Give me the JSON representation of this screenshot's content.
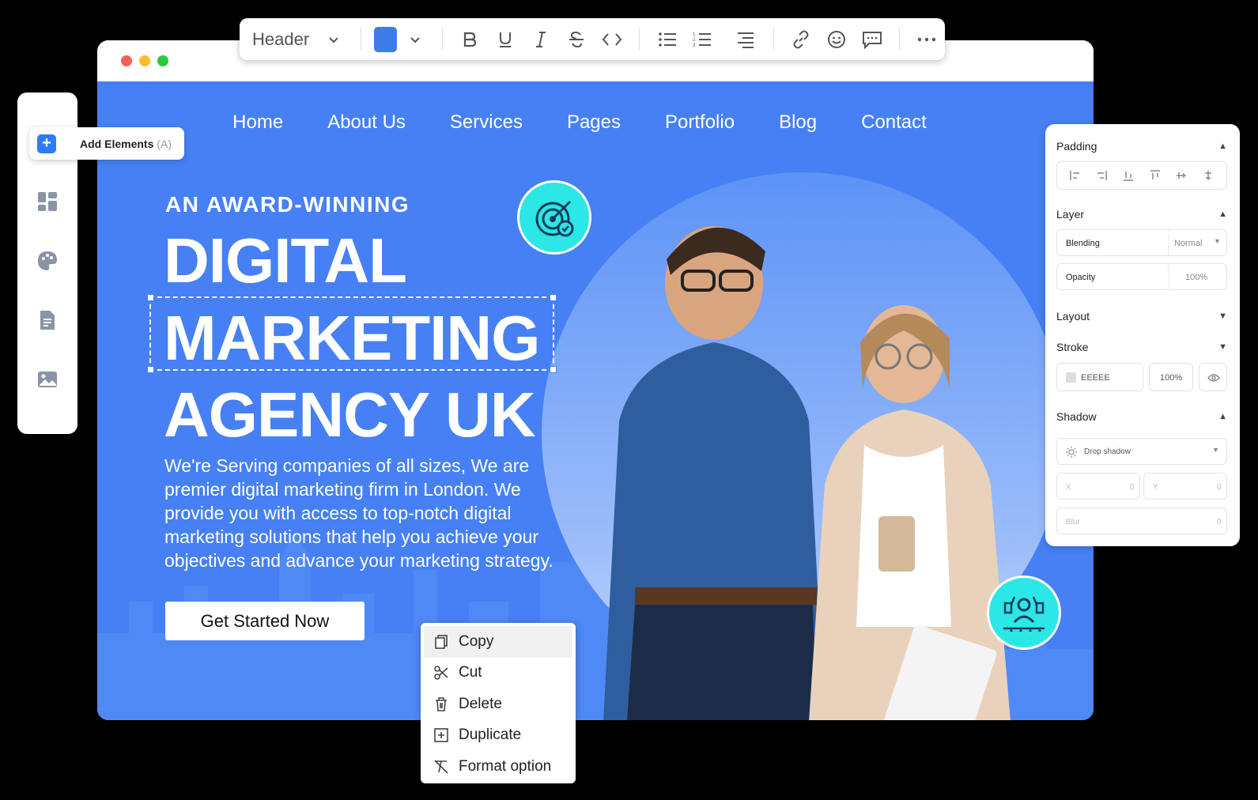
{
  "toolbar": {
    "block_type": "Header",
    "accent_color": "#3f7be8"
  },
  "sidebar": {
    "add_label": "Add Elements",
    "add_shortcut": "(A)",
    "icons": [
      "dashboard-icon",
      "palette-icon",
      "document-icon",
      "image-icon"
    ]
  },
  "site": {
    "nav": [
      "Home",
      "About Us",
      "Services",
      "Pages",
      "Portfolio",
      "Blog",
      "Contact"
    ],
    "eyebrow": "AN AWARD-WINNING",
    "headline_1": "DIGITAL",
    "headline_2": "MARKETING",
    "headline_3": "AGENCY UK",
    "description": "We're Serving companies of all sizes, We are premier digital marketing firm in London. We provide you with access to top-notch digital marketing solutions that help you achieve your objectives and advance your marketing strategy.",
    "cta": "Get Started Now",
    "bg_color": "#4680f4",
    "badge_color": "#2de6e6"
  },
  "panel": {
    "padding": "Padding",
    "layer": "Layer",
    "blending_label": "Blending",
    "blending_value": "Normal",
    "opacity_label": "Opacity",
    "opacity_value": "100%",
    "layout": "Layout",
    "stroke": "Stroke",
    "stroke_color": "EEEEE",
    "stroke_opacity": "100%",
    "shadow": "Shadow",
    "shadow_type": "Drop shadow",
    "x_label": "X",
    "x_value": "0",
    "y_label": "Y",
    "y_value": "0",
    "blur_label": "Blur",
    "blur_value": "0"
  },
  "context_menu": {
    "items": [
      "Copy",
      "Cut",
      "Delete",
      "Duplicate",
      "Format option"
    ]
  }
}
